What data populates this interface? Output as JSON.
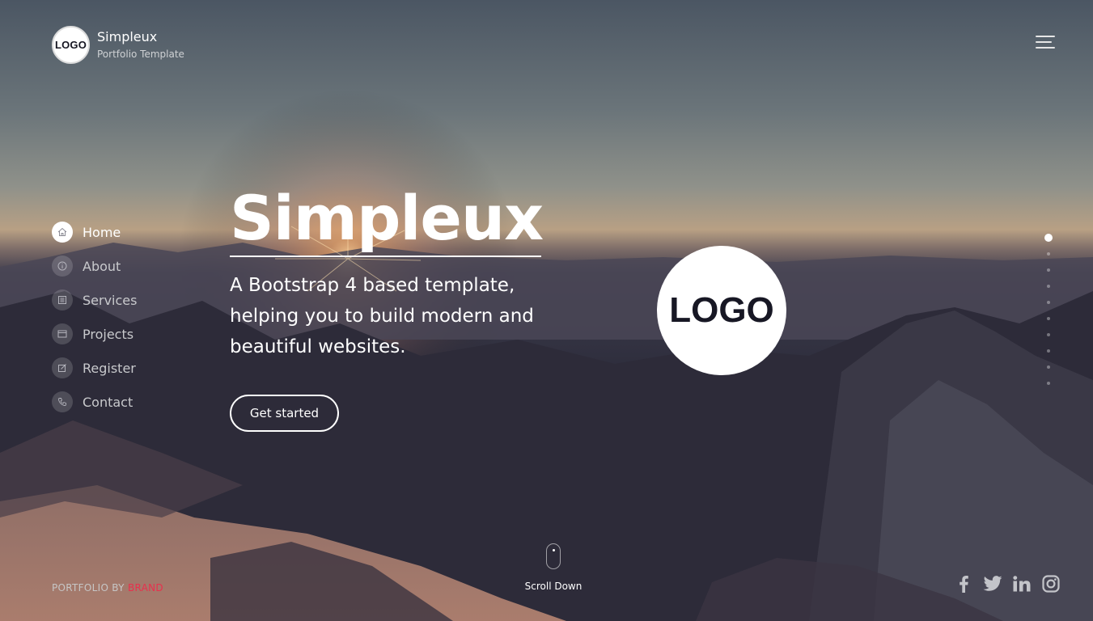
{
  "header": {
    "logo_text": "LOGO",
    "brand_name": "Simpleux",
    "brand_subtitle": "Portfolio Template",
    "menu_icon": "hamburger-icon"
  },
  "nav": {
    "items": [
      {
        "label": "Home",
        "icon": "home-icon",
        "active": true
      },
      {
        "label": "About",
        "icon": "info-icon",
        "active": false
      },
      {
        "label": "Services",
        "icon": "list-icon",
        "active": false
      },
      {
        "label": "Projects",
        "icon": "window-icon",
        "active": false
      },
      {
        "label": "Register",
        "icon": "edit-icon",
        "active": false
      },
      {
        "label": "Contact",
        "icon": "phone-icon",
        "active": false
      }
    ]
  },
  "hero": {
    "title": "Simpleux",
    "description": "A Bootstrap 4 based template, helping you to build modern and beautiful websites.",
    "cta_label": "Get started",
    "logo_text": "LOGO"
  },
  "section_dots": {
    "count": 10,
    "active_index": 0
  },
  "footer": {
    "brand_prefix": "PORTFOLIO BY",
    "brand_accent": "BRAND",
    "scroll_label": "Scroll Down",
    "social_icons": [
      "facebook-icon",
      "twitter-icon",
      "linkedin-icon",
      "instagram-icon"
    ]
  },
  "colors": {
    "accent": "#e8304d",
    "text": "#ffffff",
    "logo_dark": "#171724"
  }
}
